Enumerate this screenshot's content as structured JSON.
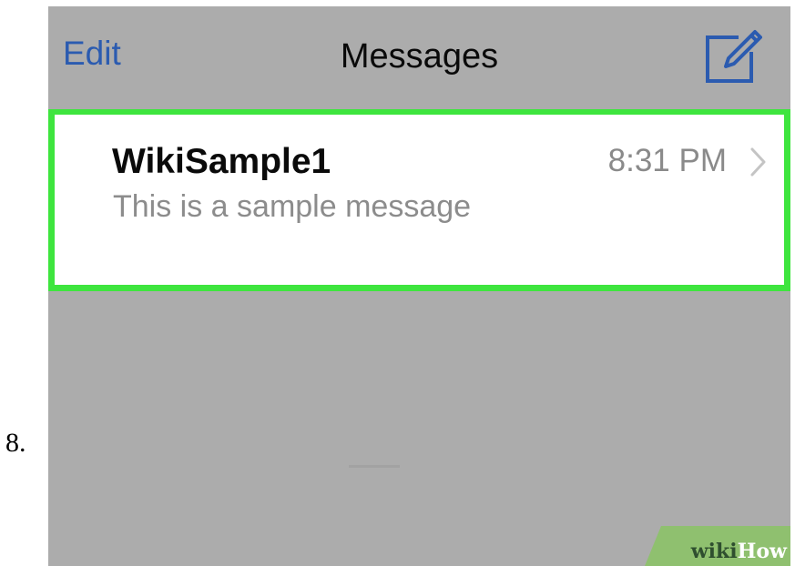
{
  "step": {
    "number": "8."
  },
  "navbar": {
    "edit_label": "Edit",
    "title": "Messages",
    "compose_icon": "compose-icon"
  },
  "conversations": [
    {
      "name": "WikiSample1",
      "time": "8:31 PM",
      "preview": "This is a sample message",
      "highlighted": true,
      "chevron_icon": "chevron-right-icon"
    }
  ],
  "watermark": {
    "part1": "wiki",
    "part2": "How"
  },
  "colors": {
    "highlight": "#3ee53e",
    "link_blue": "#2b5bb0",
    "screen_gray": "#acacac",
    "row_white": "#ffffff"
  }
}
